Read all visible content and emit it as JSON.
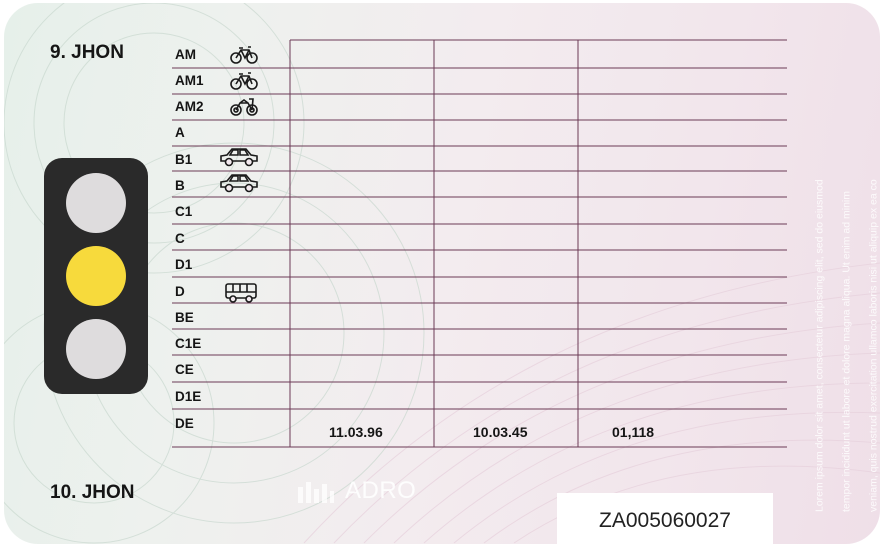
{
  "field9": "9.  JHON",
  "field10": "10.  JHON",
  "categories": [
    {
      "code": "AM",
      "icon": "bicycle-icon"
    },
    {
      "code": "AM1",
      "icon": "bicycle-icon"
    },
    {
      "code": "AM2",
      "icon": "motorcycle-icon"
    },
    {
      "code": "A",
      "icon": ""
    },
    {
      "code": "B1",
      "icon": "car-icon"
    },
    {
      "code": "B",
      "icon": "car-icon"
    },
    {
      "code": "C1",
      "icon": ""
    },
    {
      "code": "C",
      "icon": ""
    },
    {
      "code": "D1",
      "icon": ""
    },
    {
      "code": "D",
      "icon": "bus-icon"
    },
    {
      "code": "BE",
      "icon": ""
    },
    {
      "code": "C1E",
      "icon": ""
    },
    {
      "code": "CE",
      "icon": ""
    },
    {
      "code": "D1E",
      "icon": ""
    },
    {
      "code": "DE",
      "icon": ""
    }
  ],
  "de_row": {
    "issue_date": "11.03.96",
    "expiry_date": "10.03.45",
    "restriction": "01,118"
  },
  "traffic_light": {
    "active": "middle",
    "active_color": "#f7da3c",
    "inactive_color": "#dedcdd",
    "body_color": "#2a2a2a"
  },
  "lorem": [
    "Lorem ipsum dolor sit amet, consectetur adipiscing elit, sed do eiusmod",
    "tempor incididunt ut labore et dolore magna aliqua. Ut enim ad minim",
    "veniam, quis nostrud exercitation ullamco laboris nisi ut aliquip ex ea co"
  ],
  "brand": "ADRO",
  "serial": "ZA005060027",
  "colors": {
    "grid_line": "#6b3a55",
    "card_tint": "#f2e6ec"
  }
}
